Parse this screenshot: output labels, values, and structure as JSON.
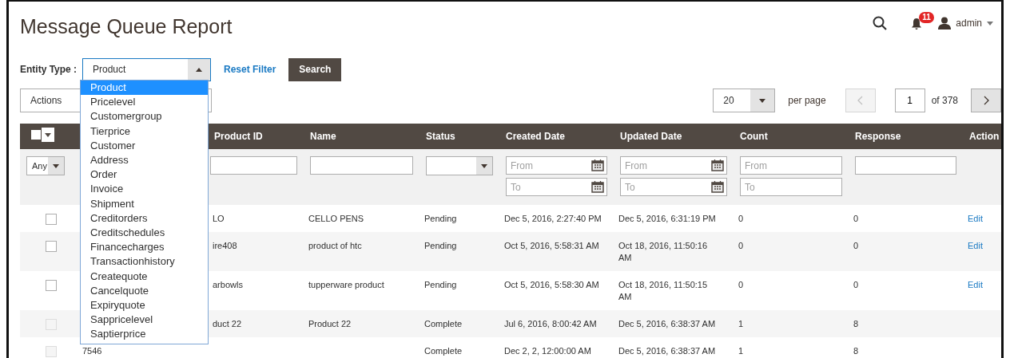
{
  "header": {
    "title": "Message Queue Report",
    "notification_count": "11",
    "user": "admin"
  },
  "filter": {
    "label": "Entity Type :",
    "value": "Product",
    "expanded": true,
    "reset_link": "Reset Filter",
    "search_button": "Search",
    "options": [
      {
        "label": "Product",
        "selected": true
      },
      {
        "label": "Pricelevel",
        "selected": false
      },
      {
        "label": "Customergroup",
        "selected": false
      },
      {
        "label": "Tierprice",
        "selected": false
      },
      {
        "label": "Customer",
        "selected": false
      },
      {
        "label": "Address",
        "selected": false
      },
      {
        "label": "Order",
        "selected": false
      },
      {
        "label": "Invoice",
        "selected": false
      },
      {
        "label": "Shipment",
        "selected": false
      },
      {
        "label": "Creditorders",
        "selected": false
      },
      {
        "label": "Creditschedules",
        "selected": false
      },
      {
        "label": "Financecharges",
        "selected": false
      },
      {
        "label": "Transactionhistory",
        "selected": false
      },
      {
        "label": "Createquote",
        "selected": false
      },
      {
        "label": "Cancelquote",
        "selected": false
      },
      {
        "label": "Expiryquote",
        "selected": false
      },
      {
        "label": "Sappricelevel",
        "selected": false
      },
      {
        "label": "Saptierprice",
        "selected": false
      }
    ]
  },
  "toolbar": {
    "actions": "Actions",
    "per_page": "20",
    "per_page_label": "per page",
    "prev_disabled": true,
    "page": "1",
    "page_total": "of 378"
  },
  "grid": {
    "columns": [
      "Product ID",
      "Name",
      "Status",
      "Created Date",
      "Updated Date",
      "Count",
      "Response",
      "Action"
    ],
    "select_all": {
      "checked": false
    },
    "filters": {
      "any": "Any",
      "created": [
        {
          "placeholder": "From"
        },
        {
          "placeholder": "To"
        }
      ],
      "updated": [
        {
          "placeholder": "From"
        },
        {
          "placeholder": "To"
        }
      ],
      "count": [
        {
          "placeholder": "From"
        },
        {
          "placeholder": "To"
        }
      ]
    },
    "rows": [
      {
        "checked": false,
        "disabled": false,
        "product_id": "LO",
        "name": "CELLO PENS",
        "status": "Pending",
        "created": "Dec 5, 2016, 2:27:40 PM",
        "updated": "Dec 5, 2016, 6:31:19 PM",
        "count": "0",
        "response": "0",
        "action": "Edit"
      },
      {
        "checked": false,
        "disabled": false,
        "product_id": "ire408",
        "name": "product of htc",
        "status": "Pending",
        "created": "Oct 5, 2016, 5:58:31 AM",
        "updated": "Oct 18, 2016, 11:50:16 AM",
        "count": "0",
        "response": "0",
        "action": "Edit"
      },
      {
        "checked": false,
        "disabled": false,
        "product_id": "arbowls",
        "name": "tupperware product",
        "status": "Pending",
        "created": "Oct 5, 2016, 5:58:30 AM",
        "updated": "Oct 18, 2016, 11:50:15 AM",
        "count": "0",
        "response": "0",
        "action": "Edit"
      },
      {
        "checked": false,
        "disabled": true,
        "product_id": "duct 22",
        "name": "Product 22",
        "status": "Complete",
        "created": "Jul 6, 2016, 8:00:42 AM",
        "updated": "Dec 5, 2016, 6:38:37 AM",
        "count": "1",
        "response": "8"
      },
      {
        "checked": false,
        "disabled": true,
        "id": "7546",
        "status": "Complete",
        "created": "Dec 2, 2, 12:00:00 AM",
        "updated": "Dec 5, 2016, 6:38:37 AM",
        "count": "1",
        "response": "8"
      }
    ]
  }
}
